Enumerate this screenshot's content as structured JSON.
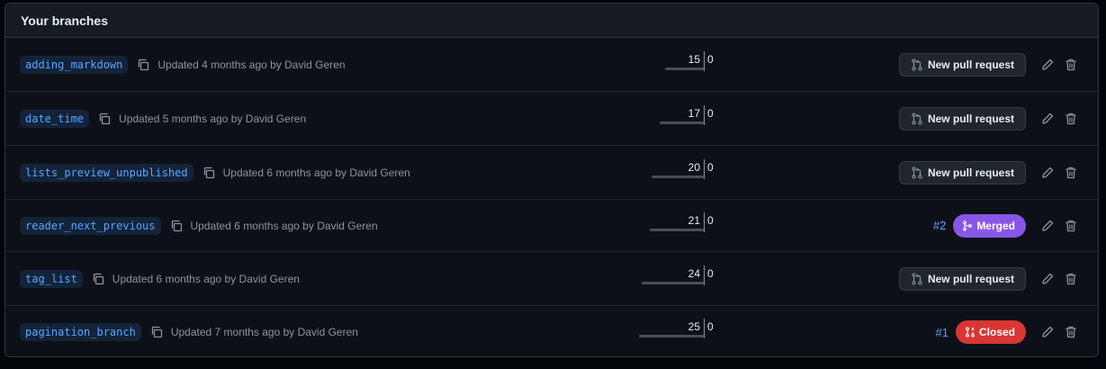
{
  "header": {
    "title": "Your branches"
  },
  "branches": [
    {
      "name": "adding_markdown",
      "updated": "Updated 4 months ago by David Geren",
      "behind": "15",
      "ahead": "0",
      "behind_bar_fraction": 0.6,
      "action": "pr",
      "pr_label": "New pull request"
    },
    {
      "name": "date_time",
      "updated": "Updated 5 months ago by David Geren",
      "behind": "17",
      "ahead": "0",
      "behind_bar_fraction": 0.68,
      "action": "pr",
      "pr_label": "New pull request"
    },
    {
      "name": "lists_preview_unpublished",
      "updated": "Updated 6 months ago by David Geren",
      "behind": "20",
      "ahead": "0",
      "behind_bar_fraction": 0.8,
      "action": "pr",
      "pr_label": "New pull request"
    },
    {
      "name": "reader_next_previous",
      "updated": "Updated 6 months ago by David Geren",
      "behind": "21",
      "ahead": "0",
      "behind_bar_fraction": 0.84,
      "action": "status",
      "pr_number": "#2",
      "status": "Merged"
    },
    {
      "name": "tag_list",
      "updated": "Updated 6 months ago by David Geren",
      "behind": "24",
      "ahead": "0",
      "behind_bar_fraction": 0.96,
      "action": "pr",
      "pr_label": "New pull request"
    },
    {
      "name": "pagination_branch",
      "updated": "Updated 7 months ago by David Geren",
      "behind": "25",
      "ahead": "0",
      "behind_bar_fraction": 1.0,
      "action": "status",
      "pr_number": "#1",
      "status": "Closed"
    }
  ],
  "icons": {
    "copy": "copy-icon",
    "pr": "git-pull-request-icon",
    "merge": "git-merge-icon",
    "closed": "git-pull-request-closed-icon",
    "edit": "pencil-icon",
    "delete": "trash-icon"
  },
  "colors": {
    "background": "#0d1117",
    "link": "#58a6ff",
    "merged": "#8957e5",
    "closed": "#da3633"
  }
}
